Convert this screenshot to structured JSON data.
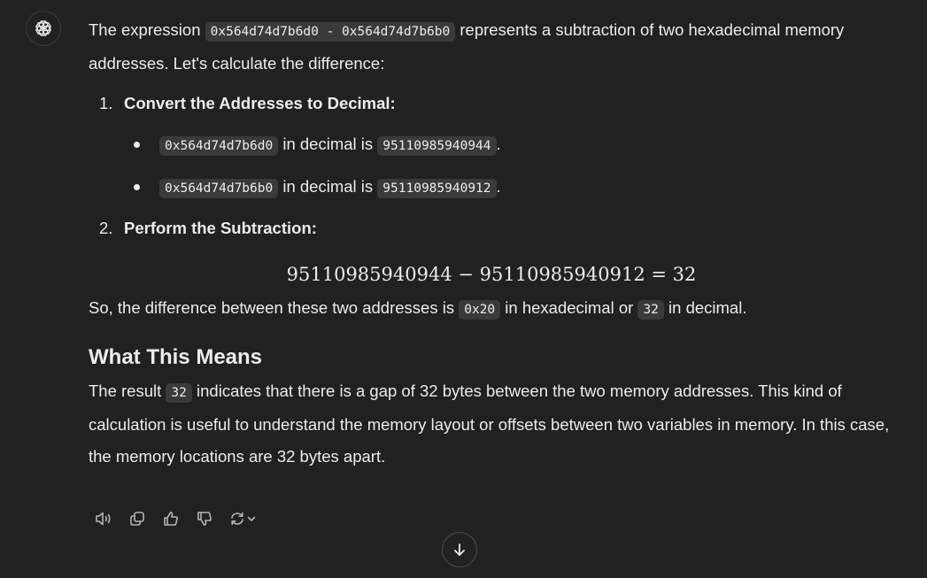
{
  "message": {
    "intro_pre": "The expression ",
    "intro_code": "0x564d74d7b6d0 - 0x564d74d7b6b0",
    "intro_post": " represents a subtraction of two hexadecimal memory addresses. Let's calculate the difference:",
    "steps": [
      {
        "number": "1.",
        "title": "Convert the Addresses to Decimal:",
        "bullets": [
          {
            "hex": "0x564d74d7b6d0",
            "mid": " in decimal is ",
            "dec": "95110985940944",
            "end": "."
          },
          {
            "hex": "0x564d74d7b6b0",
            "mid": " in decimal is ",
            "dec": "95110985940912",
            "end": "."
          }
        ]
      },
      {
        "number": "2.",
        "title": "Perform the Subtraction:"
      }
    ],
    "equation": "95110985940944 − 95110985940912 = 32",
    "summary": {
      "pre": "So, the difference between these two addresses is ",
      "hex": "0x20",
      "mid": " in hexadecimal or ",
      "dec": "32",
      "end": " in decimal."
    },
    "section_heading": "What This Means",
    "paragraph": {
      "pre": "The result ",
      "code": "32",
      "post": " indicates that there is a gap of 32 bytes between the two memory addresses. This kind of calculation is useful to understand the memory layout or offsets between two variables in memory. In this case, the memory locations are 32 bytes apart."
    }
  },
  "actions": [
    {
      "icon": "speaker-icon"
    },
    {
      "icon": "copy-icon"
    },
    {
      "icon": "thumbs-up-icon"
    },
    {
      "icon": "thumbs-down-icon"
    },
    {
      "icon": "regenerate-icon"
    }
  ],
  "colors": {
    "background": "#212121",
    "text": "#ececec",
    "code_bg": "#3a3a3a",
    "icon": "#b4b4b4"
  }
}
